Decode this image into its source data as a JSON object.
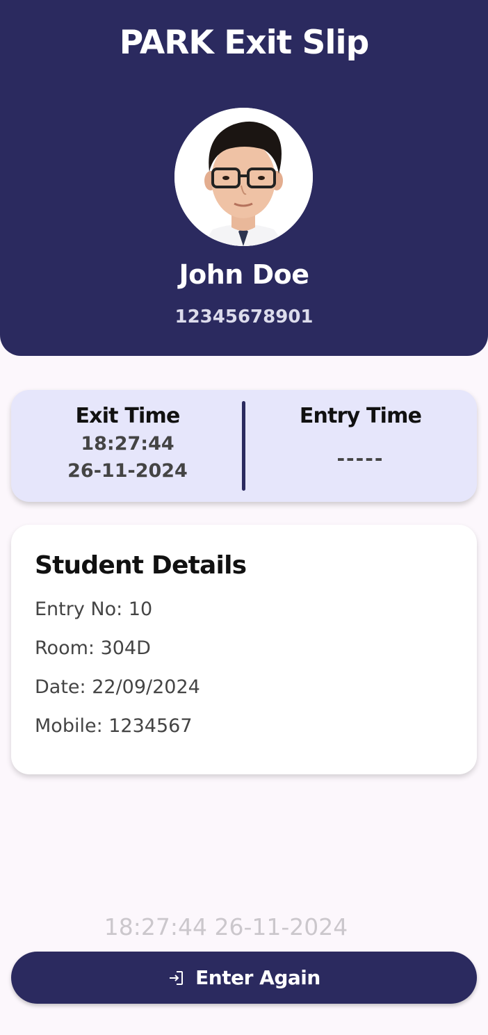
{
  "header": {
    "title": "PARK Exit Slip",
    "name": "John Doe",
    "student_id": "12345678901"
  },
  "times": {
    "exit_label": "Exit Time",
    "exit_time": "18:27:44",
    "exit_date": "26-11-2024",
    "entry_label": "Entry Time",
    "entry_value": "-----"
  },
  "details": {
    "title": "Student Details",
    "entry_no": "Entry No: 10",
    "room": "Room: 304D",
    "date": "Date: 22/09/2024",
    "mobile": "Mobile: 1234567"
  },
  "footer": {
    "current_time": "18:27:44 26-11-2024",
    "button_label": "Enter Again",
    "button_icon": "login-icon"
  },
  "colors": {
    "primary": "#2b2a5f",
    "time_card_bg": "#e6e6fb",
    "page_bg": "#fcf7fc"
  }
}
